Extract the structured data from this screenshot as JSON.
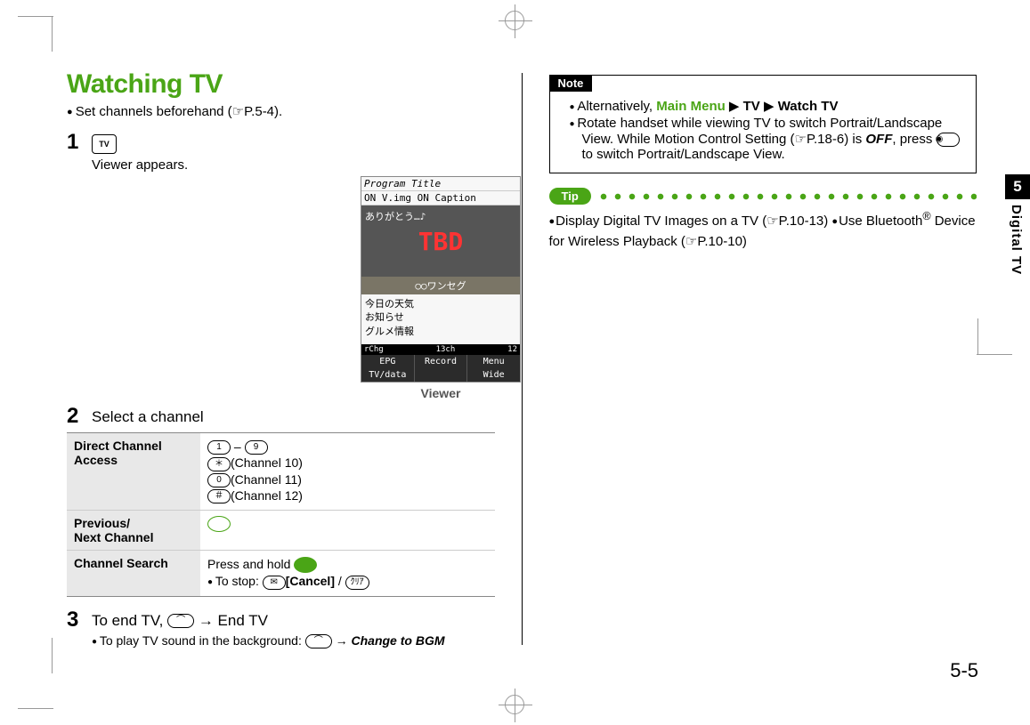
{
  "pageNumber": "5-5",
  "sideTab": {
    "chapter": "5",
    "label": "Digital TV"
  },
  "heading": "Watching TV",
  "lead": "Set channels beforehand (☞P.5-4).",
  "step1": {
    "num": "1",
    "iconLabel": "TV",
    "text": "Viewer appears."
  },
  "viewer": {
    "caption": "Viewer",
    "programTitle": "Program Title",
    "onvLine": "ON V.img ON Caption",
    "overlayJP": "ありがとう…♪",
    "thumbText": "TBD",
    "captionBar": "○○ワンセグ",
    "dataLines": "今日の天気\nお知らせ\nグルメ情報",
    "statusLeft": "rChg",
    "statusMid": "13ch",
    "statusRight": "12",
    "sk1": "EPG",
    "sk2": "Record",
    "sk3": "Menu",
    "sk4": "TV/data",
    "sk5": "Wide"
  },
  "step2": {
    "num": "2",
    "text": "Select a channel"
  },
  "table": {
    "row1": {
      "label": "Direct Channel Access",
      "rangeDash": " – ",
      "ch10": "(Channel 10)",
      "ch11": "(Channel 11)",
      "ch12": "(Channel 12)"
    },
    "row2": {
      "label": "Previous/\nNext Channel"
    },
    "row3": {
      "label": "Channel Search",
      "line1": "Press and hold ",
      "stopPrefix": "To stop: ",
      "cancel": "[Cancel]",
      "slash": " / "
    }
  },
  "step3": {
    "num": "3",
    "textA": "To end TV, ",
    "arrow": " → ",
    "textB": "End TV",
    "subA": "To play TV sound in the background: ",
    "subB": "Change to BGM"
  },
  "note": {
    "tab": "Note",
    "item1a": "Alternatively, ",
    "item1b": "Main Menu",
    "item1c": " ▶ ",
    "item1d": "TV",
    "item1e": " ▶ ",
    "item1f": "Watch TV",
    "item2a": "Rotate handset while viewing TV to switch Portrait/Landscape View. While Motion Control Setting (☞P.18-6) is ",
    "item2off": "OFF",
    "item2b": ", press ",
    "item2c": " to switch Portrait/Landscape View."
  },
  "tip": {
    "label": "Tip",
    "part1": "Display Digital TV Images on a TV (☞P.10-13) ",
    "part2a": "Use Bluetooth",
    "sup": "®",
    "part2b": " Device for Wireless Playback (☞P.10-10)"
  },
  "keys": {
    "k1": "1",
    "k9": "9",
    "kStar": "＊",
    "k0": "0",
    "kHash": "＃",
    "callGlyph": "⌒",
    "mailGlyph": "✉",
    "clearGlyph": "ｸﾘｱ",
    "cameraGlyph": "◉"
  }
}
